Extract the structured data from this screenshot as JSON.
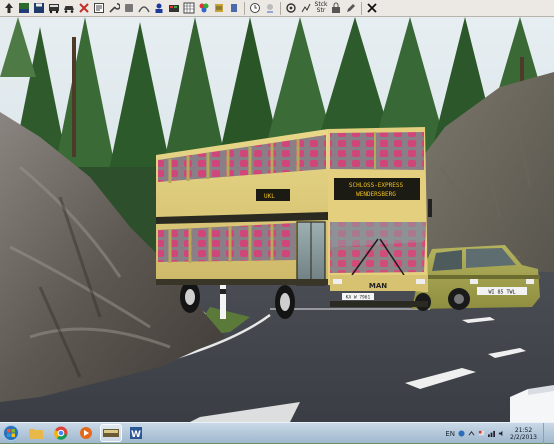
{
  "toolbar": {
    "stack_label_top": "Stck",
    "stack_label_bottom": "Str",
    "icons": [
      "map-icon",
      "terrain-icon",
      "save-icon",
      "bus-icon",
      "car-icon",
      "timetable-icon",
      "wrench-icon",
      "spline-icon",
      "object-icon",
      "ai-icon",
      "settings-icon",
      "camera-icon",
      "flag-icon",
      "stop-icon",
      "weather-icon",
      "clock-icon",
      "fps-icon",
      "cam-icon",
      "stack-icon",
      "exit-icon"
    ]
  },
  "scene": {
    "bus_destination_line1": "SCHLOSS-EXPRESS",
    "bus_destination_line2": "WENDERSBERG",
    "bus_route": "UKL",
    "bus_front_plate": "KA W 7961",
    "bus_brand": "MAN",
    "car_plate": "WI 85 TWL"
  },
  "taskbar": {
    "language": "EN",
    "time": "21:52",
    "date": "2/2/2013",
    "apps": [
      "start-orb",
      "file-explorer",
      "chrome",
      "media-player",
      "omsi",
      "word"
    ]
  }
}
